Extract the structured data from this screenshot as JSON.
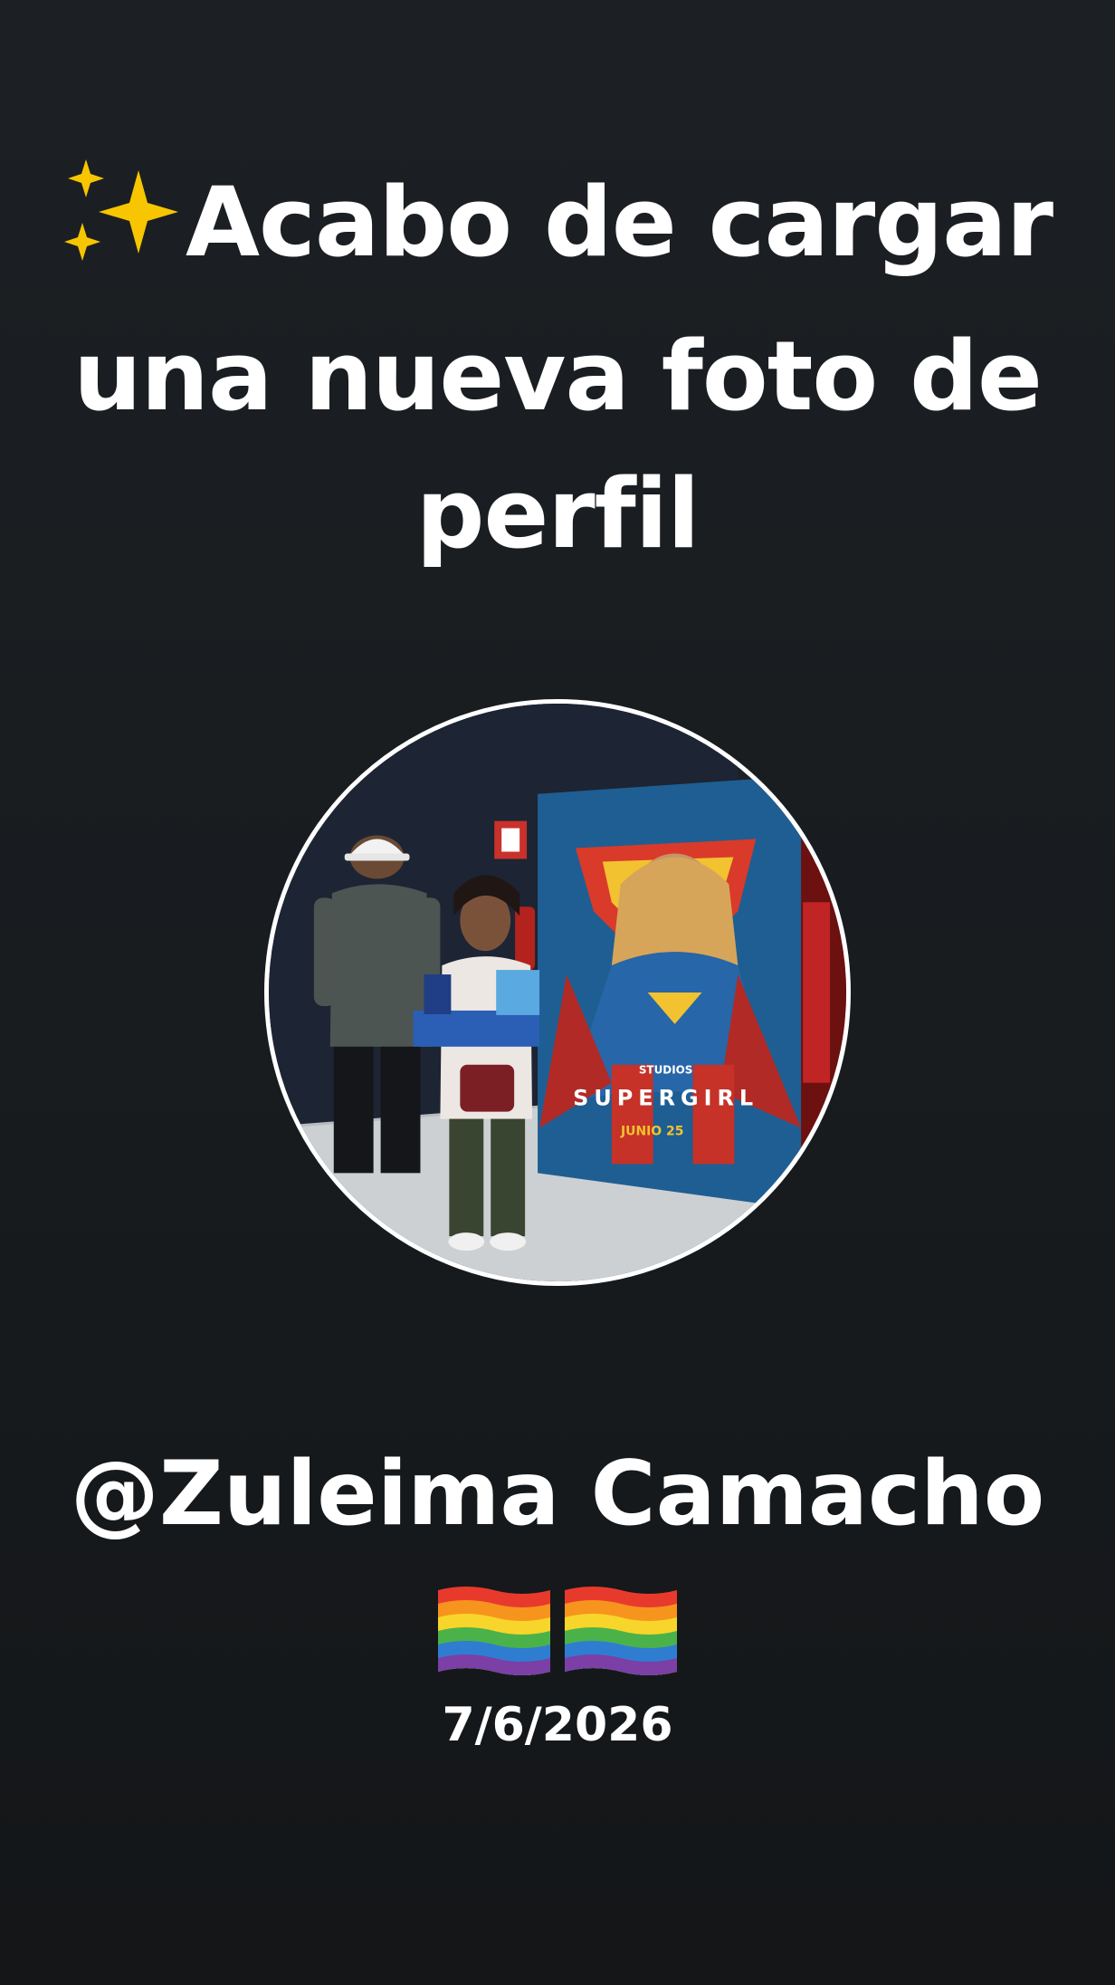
{
  "headline": {
    "sparkle_icon": "sparkles-icon",
    "lines": [
      "Acabo de cargar",
      "una nueva foto de",
      "perfil"
    ]
  },
  "profile_photo": {
    "poster_brand": "STUDIOS",
    "poster_title": "SUPERGIRL",
    "poster_date": "JUNIO 25"
  },
  "username": "@Zuleima Camacho",
  "flags": [
    "rainbow-flag-icon",
    "rainbow-flag-icon"
  ],
  "date": "7/6/2026",
  "colors": {
    "background": "#1a1e21",
    "text": "#ffffff",
    "ring": "#ffffff"
  }
}
